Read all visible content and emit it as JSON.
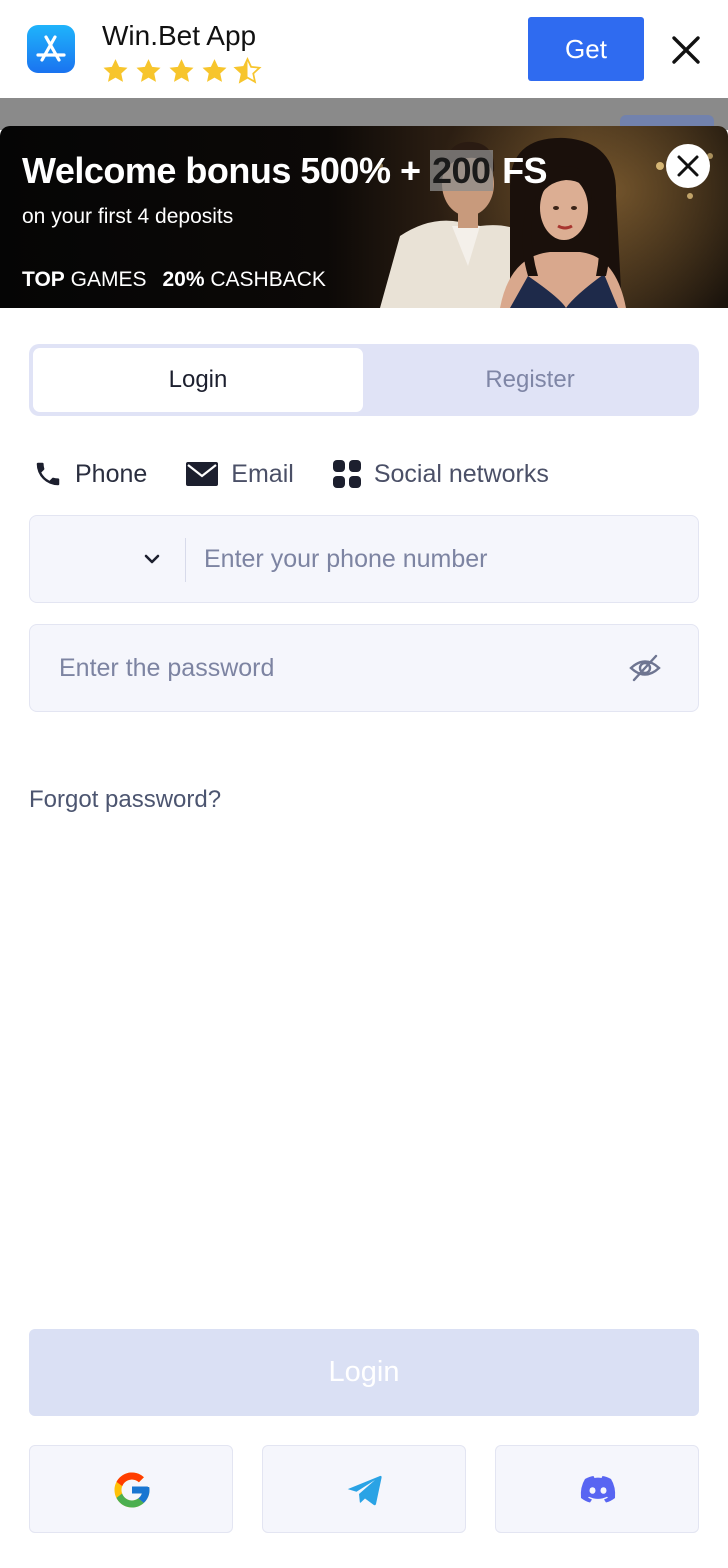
{
  "app_banner": {
    "name": "Win.Bet App",
    "rating_stars": 4.5,
    "get_label": "Get",
    "icon": "app-store-icon"
  },
  "promo": {
    "title_pre": "Welcome bonus 500% + ",
    "title_hl": "200",
    "title_post": " FS",
    "subtitle": "on your first 4 deposits",
    "tag1_bold": "TOP",
    "tag1_rest": " GAMES",
    "tag2_bold": "20%",
    "tag2_rest": " CASHBACK"
  },
  "tabs": {
    "login": "Login",
    "register": "Register",
    "active": "login"
  },
  "methods": [
    {
      "label": "Phone",
      "icon": "phone-icon"
    },
    {
      "label": "Email",
      "icon": "envelope-icon"
    },
    {
      "label": "Social networks",
      "icon": "grid-icon"
    }
  ],
  "phone_field": {
    "placeholder": "Enter your phone number",
    "value": ""
  },
  "password_field": {
    "placeholder": "Enter the password",
    "value": ""
  },
  "forgot": "Forgot password?",
  "login_button": "Login",
  "social_logins": [
    "google-icon",
    "telegram-icon",
    "discord-icon"
  ],
  "colors": {
    "accent": "#2f6bf0",
    "tab_bg": "#e0e3f6",
    "disabled_button": "#dae0f4",
    "star": "#f7c52c"
  }
}
